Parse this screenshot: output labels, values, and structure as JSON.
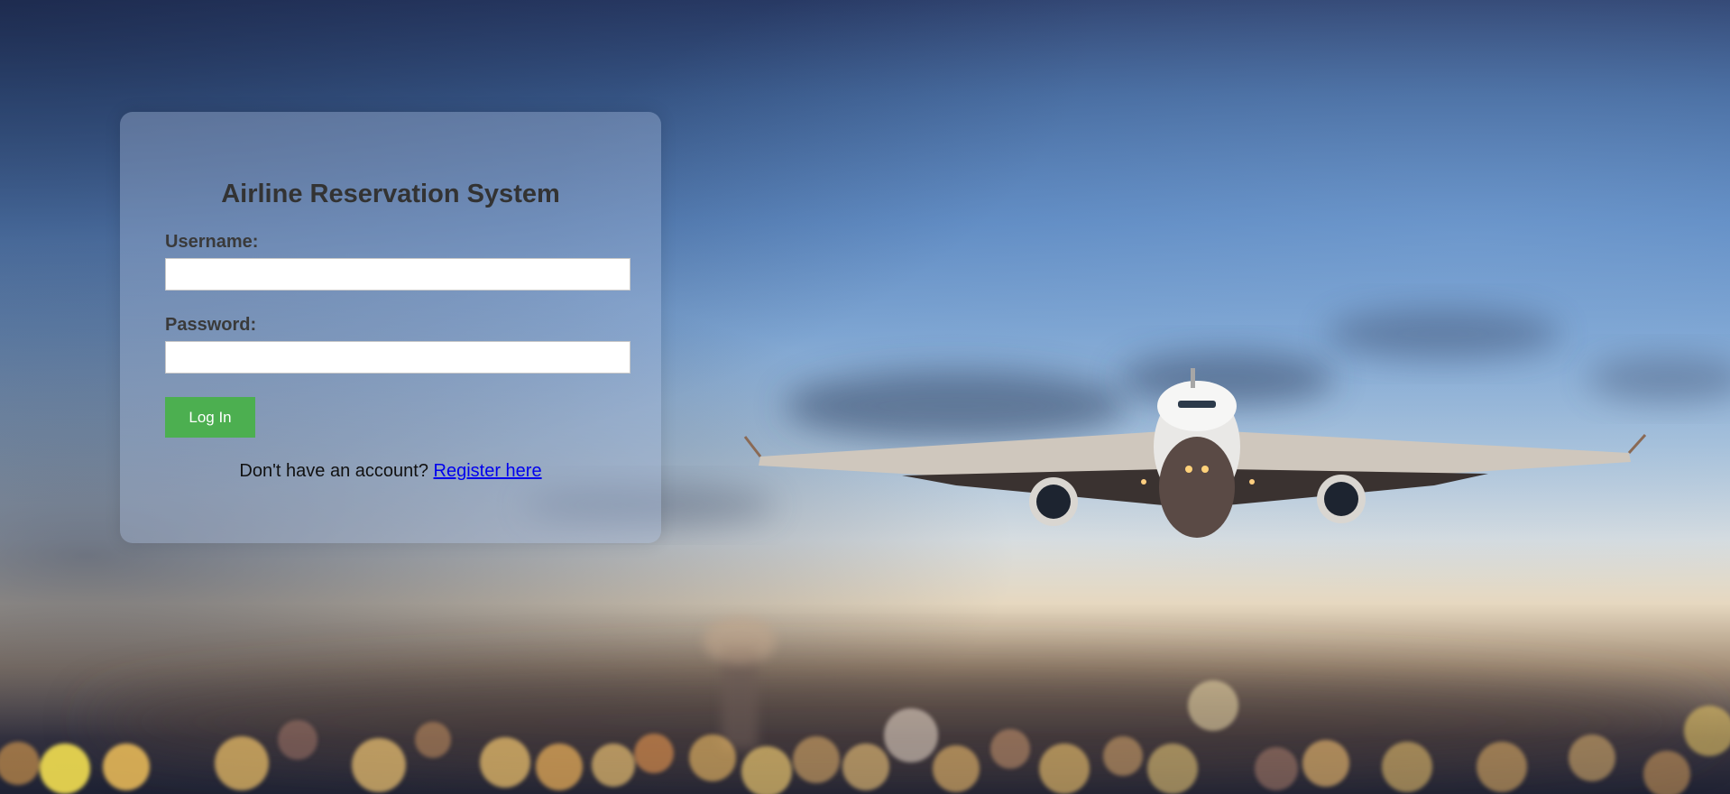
{
  "login": {
    "title": "Airline Reservation System",
    "username_label": "Username:",
    "username_value": "",
    "password_label": "Password:",
    "password_value": "",
    "submit_label": "Log In",
    "register_prompt": "Don't have an account?",
    "register_link": "Register here"
  },
  "colors": {
    "button": "#4caf50",
    "title_text": "#333333",
    "link": "#0000ee"
  },
  "background": {
    "subject": "airplane-in-flight-at-dusk",
    "icon": "airplane-icon"
  }
}
